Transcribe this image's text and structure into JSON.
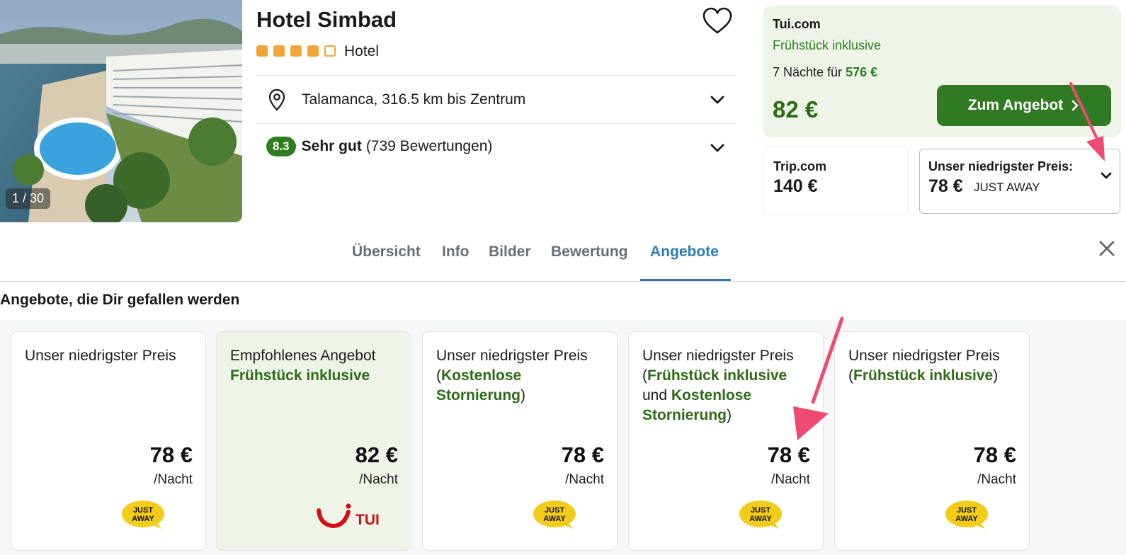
{
  "hotel": {
    "name": "Hotel Simbad",
    "type": "Hotel",
    "stars_filled": 4,
    "stars_total": 5,
    "photo_counter": "1 / 30",
    "location": "Talamanca, 316.5 km bis Zentrum",
    "rating_score": "8.3",
    "rating_label": "Sehr gut",
    "rating_count": "(739 Bewertungen)"
  },
  "top_offer": {
    "provider": "Tui.com",
    "breakfast": "Frühstück inklusive",
    "nights_prefix": "7 Nächte für",
    "nights_total": "576 €",
    "price": "82 €",
    "cta": "Zum Angebot"
  },
  "alt_offer": {
    "provider": "Trip.com",
    "price": "140 €"
  },
  "lowest": {
    "label": "Unser niedrigster Preis:",
    "price": "78 €",
    "provider": "JUST AWAY"
  },
  "tabs": [
    {
      "label": "Übersicht"
    },
    {
      "label": "Info"
    },
    {
      "label": "Bilder"
    },
    {
      "label": "Bewertung"
    },
    {
      "label": "Angebote"
    }
  ],
  "section_title": "Angebote, die Dir gefallen werden",
  "offers": [
    {
      "line1": "Unser niedrigster Preis",
      "price": "78 €",
      "per_night": "/Nacht",
      "logo": "JUST AWAY"
    },
    {
      "line1": "Empfohlenes Angebot",
      "green1": "Frühstück inklusive",
      "price": "82 €",
      "per_night": "/Nacht",
      "logo": "TUI"
    },
    {
      "line1": "Unser niedrigster Preis",
      "open": "(",
      "green1": "Kostenlose Stornierung",
      "close": ")",
      "price": "78 €",
      "per_night": "/Nacht",
      "logo": "JUST AWAY"
    },
    {
      "line1": "Unser niedrigster Preis",
      "open": "(",
      "green1": "Frühstück inklusive",
      "mid": "und",
      "green2": "Kostenlose Stornierung",
      "close": ")",
      "price": "78 €",
      "per_night": "/Nacht",
      "logo": "JUST AWAY"
    },
    {
      "line1": "Unser niedrigster Preis",
      "open": "(",
      "green1": "Frühstück inklusive",
      "close": ")",
      "price": "78 €",
      "per_night": "/Nacht",
      "logo": "JUST AWAY"
    }
  ],
  "colors": {
    "accent_green": "#2f7a22",
    "tab_active": "#2f7ab8",
    "annotation_arrow": "#ee4a72",
    "star": "#f0a53b",
    "tui_red": "#d40e14"
  }
}
